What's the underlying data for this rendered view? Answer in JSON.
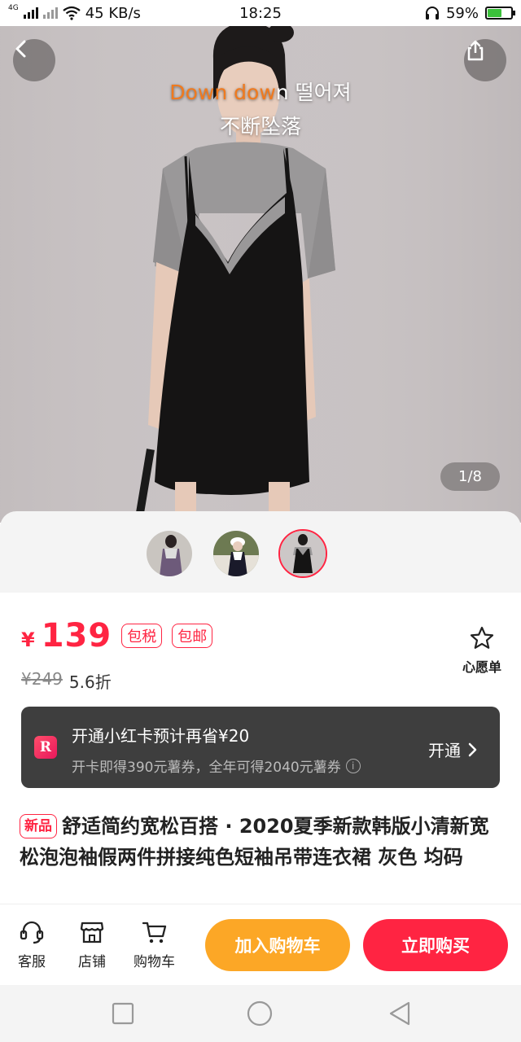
{
  "status_bar": {
    "network_label": "4G",
    "speed": "45 KB/s",
    "time": "18:25",
    "battery": "59%",
    "battery_level": 0.59
  },
  "hero": {
    "lyric_line1_highlight": "Down dow",
    "lyric_line1_rest": "n 떨어져",
    "lyric_line2": "不断坠落",
    "image_counter": "1/8"
  },
  "thumbnails": {
    "count": 3,
    "active_index": 2
  },
  "price": {
    "currency": "¥",
    "amount": "139",
    "tags": [
      "包税",
      "包邮"
    ],
    "original": "¥249",
    "discount": "5.6折"
  },
  "wishlist": {
    "label": "心愿单",
    "icon": "star-icon"
  },
  "card_banner": {
    "logo": "R",
    "title": "开通小红卡预计再省¥20",
    "subtitle": "开卡即得390元薯券，全年可得2040元薯券",
    "info": "i",
    "action": "开通"
  },
  "product": {
    "new_tag": "新品",
    "title": "舒适简约宽松百搭 · 2020夏季新款韩版小清新宽松泡泡袖假两件拼接纯色短袖吊带连衣裙  灰色 均码"
  },
  "bottom_bar": {
    "service": "客服",
    "shop": "店铺",
    "cart": "购物车",
    "add_to_cart": "加入购物车",
    "buy_now": "立即购买"
  },
  "colors": {
    "accent": "#ff2442",
    "cart_button": "#fca726",
    "banner_bg": "#3e3e3e"
  }
}
